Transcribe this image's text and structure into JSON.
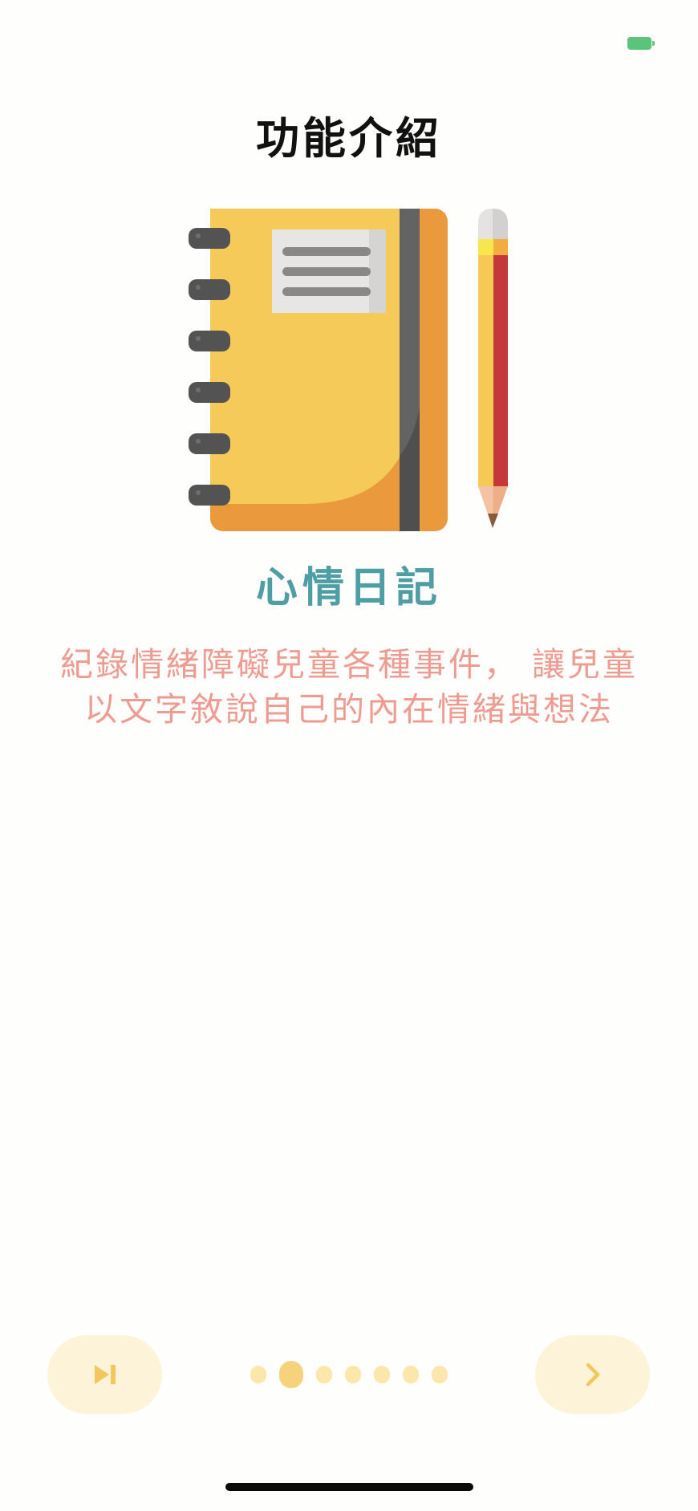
{
  "status_bar": {
    "battery_icon": "battery-icon",
    "battery_color": "#5cc47a"
  },
  "page": {
    "title": "功能介紹",
    "feature_name": "心情日記",
    "description": "紀錄情緒障礙兒童各種事件， 讓兒童以文字敘說自己的內在情緒與想法",
    "hero_icon": "notebook-with-pencil-icon"
  },
  "pager": {
    "total": 7,
    "active_index": 1,
    "active_color": "#f6d27d",
    "inactive_color": "#fbe6ac"
  },
  "buttons": {
    "skip_icon": "skip-to-end-icon",
    "next_icon": "chevron-right-icon",
    "button_bg": "#fdf3d8"
  },
  "colors": {
    "title": "#111111",
    "feature_name": "#4e9ea4",
    "description": "#ee9b92"
  }
}
